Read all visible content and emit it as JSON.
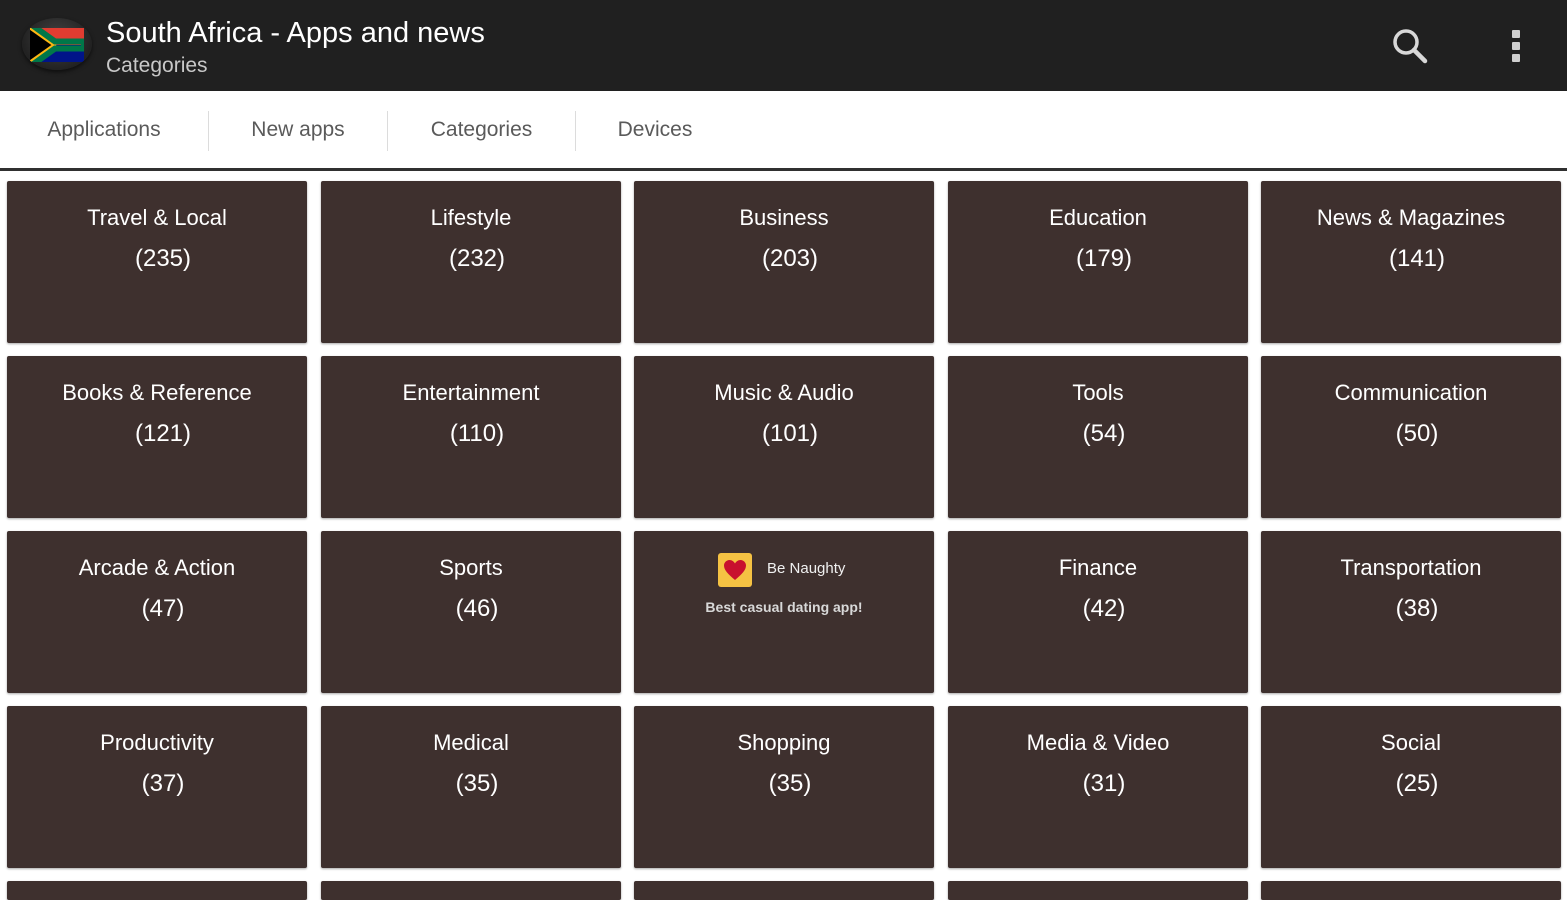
{
  "actionbar": {
    "title": "South Africa - Apps and news",
    "subtitle": "Categories",
    "app_icon": "south-africa-flag-icon",
    "actions": [
      {
        "name": "search-icon"
      },
      {
        "name": "overflow-menu-icon"
      }
    ]
  },
  "tabs": [
    {
      "label": "Applications"
    },
    {
      "label": "New apps"
    },
    {
      "label": "Categories"
    },
    {
      "label": "Devices"
    }
  ],
  "categories": [
    {
      "name": "Travel & Local",
      "count": "(235)"
    },
    {
      "name": "Lifestyle",
      "count": "(232)"
    },
    {
      "name": "Business",
      "count": "(203)"
    },
    {
      "name": "Education",
      "count": "(179)"
    },
    {
      "name": "News & Magazines",
      "count": "(141)"
    },
    {
      "name": "Books & Reference",
      "count": "(121)"
    },
    {
      "name": "Entertainment",
      "count": "(110)"
    },
    {
      "name": "Music & Audio",
      "count": "(101)"
    },
    {
      "name": "Tools",
      "count": "(54)"
    },
    {
      "name": "Communication",
      "count": "(50)"
    },
    {
      "name": "Arcade & Action",
      "count": "(47)"
    },
    {
      "name": "Sports",
      "count": "(46)"
    },
    {
      "name": "__ad__",
      "count": ""
    },
    {
      "name": "Finance",
      "count": "(42)"
    },
    {
      "name": "Transportation",
      "count": "(38)"
    },
    {
      "name": "Productivity",
      "count": "(37)"
    },
    {
      "name": "Medical",
      "count": "(35)"
    },
    {
      "name": "Shopping",
      "count": "(35)"
    },
    {
      "name": "Media & Video",
      "count": "(31)"
    },
    {
      "name": "Social",
      "count": "(25)"
    }
  ],
  "ad": {
    "app_name": "Be Naughty",
    "tagline": "Best casual dating app!",
    "icon": "heart-icon"
  },
  "colors": {
    "actionbar": "#202020",
    "tile": "#3e302e",
    "tab_text": "#5a5a5a",
    "ad_icon_bg": "#f5c243"
  }
}
